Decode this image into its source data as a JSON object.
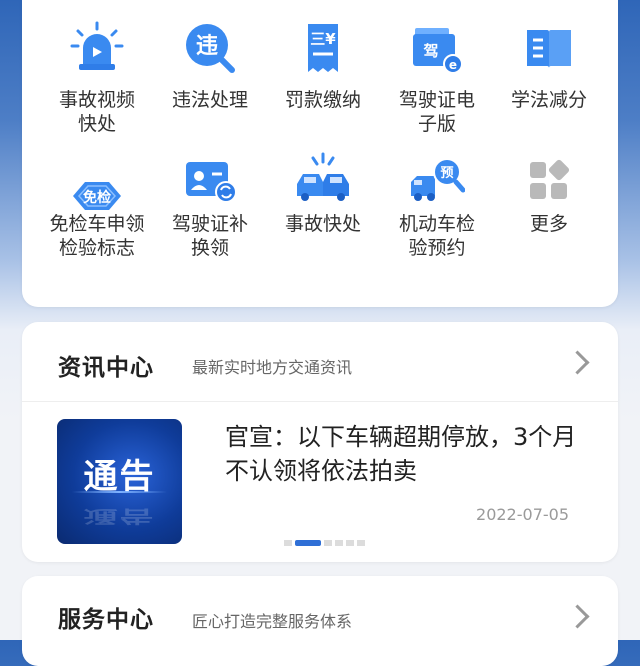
{
  "services": [
    {
      "label": "事故视频快处",
      "icon": "video-alert-icon"
    },
    {
      "label": "违法处理",
      "icon": "violation-search-icon"
    },
    {
      "label": "罚款缴纳",
      "icon": "fine-receipt-icon"
    },
    {
      "label": "驾驶证电子版",
      "icon": "e-license-icon"
    },
    {
      "label": "学法减分",
      "icon": "book-icon"
    },
    {
      "label": "免检车申领检验标志",
      "icon": "inspection-exempt-icon"
    },
    {
      "label": "驾驶证补换领",
      "icon": "license-renew-icon"
    },
    {
      "label": "事故快处",
      "icon": "car-accident-icon"
    },
    {
      "label": "机动车检验预约",
      "icon": "vehicle-booking-icon"
    },
    {
      "label": "更多",
      "icon": "more-apps-icon"
    }
  ],
  "labels_wrapped": [
    [
      "事故视频",
      "快处"
    ],
    [
      "违法处理"
    ],
    [
      "罚款缴纳"
    ],
    [
      "驾驶证电",
      "子版"
    ],
    [
      "学法减分"
    ],
    [
      "免检车申领",
      "检验标志"
    ],
    [
      "驾驶证补",
      "换领"
    ],
    [
      "事故快处"
    ],
    [
      "机动车检",
      "验预约"
    ],
    [
      "更多"
    ]
  ],
  "news": {
    "title": "资讯中心",
    "subtitle": "最新实时地方交通资讯",
    "thumb_text": "通告",
    "article_title": "官宣：以下车辆超期停放，3个月不认领将依法拍卖",
    "date": "2022-07-05",
    "carousel_total": 6,
    "carousel_active": 1
  },
  "service_center": {
    "title": "服务中心",
    "subtitle": "匠心打造完整服务体系"
  },
  "colors": {
    "accent": "#2f6fd6",
    "icon_blue": "#3a8af0"
  }
}
